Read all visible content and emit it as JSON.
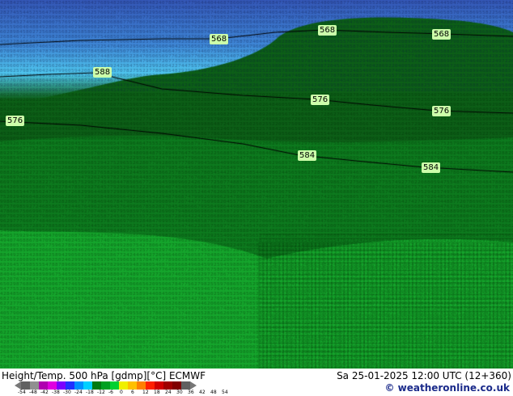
{
  "map": {
    "contour_labels": [
      "568",
      "568",
      "568",
      "588",
      "576",
      "576",
      "576",
      "584",
      "584"
    ],
    "colors": {
      "light_blue": "#4fc6ee",
      "mid_blue": "#3e86d6",
      "dark_blue": "#3457b7",
      "dark_green": "#0c5f17",
      "mid_green": "#0d7a1e",
      "bright_green": "#15a52c",
      "label_bg": "#ccffaa"
    }
  },
  "footer": {
    "title": "Height/Temp. 500 hPa [gdmp][°C] ECMWF",
    "datetime": "Sa 25-01-2025 12:00 UTC (12+360)",
    "copyright": "© weatheronline.co.uk"
  },
  "legend": {
    "ticks": [
      "-54",
      "-48",
      "-42",
      "-38",
      "-30",
      "-24",
      "-18",
      "-12",
      "-6",
      "0",
      "6",
      "12",
      "18",
      "24",
      "30",
      "36",
      "42",
      "48",
      "54"
    ],
    "colors": [
      "#606060",
      "#909090",
      "#b000b0",
      "#e000e0",
      "#7a00ff",
      "#2030ff",
      "#0090ff",
      "#00d0ff",
      "#007a10",
      "#00a020",
      "#00d030",
      "#f0f000",
      "#ffc000",
      "#ff8000",
      "#ff2000",
      "#d00000",
      "#a00000",
      "#800000",
      "#606060"
    ]
  }
}
